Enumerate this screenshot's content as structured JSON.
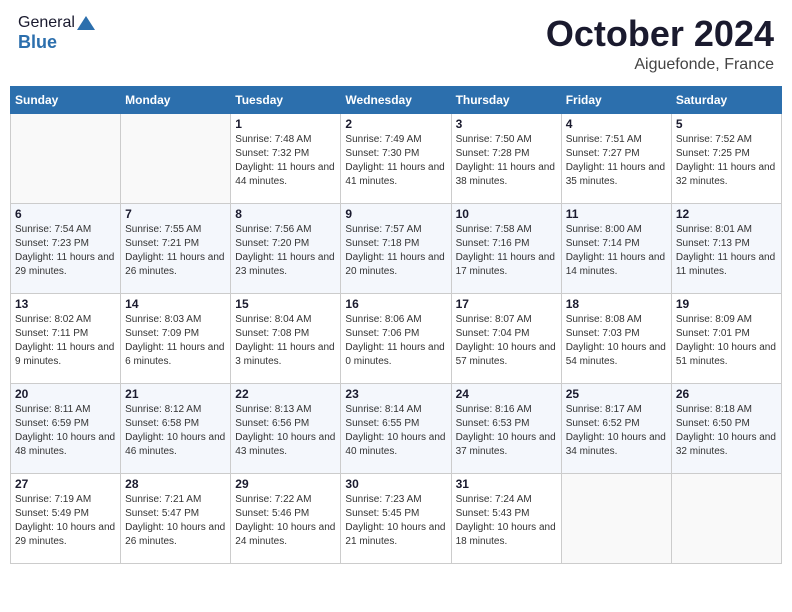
{
  "header": {
    "logo_general": "General",
    "logo_blue": "Blue",
    "month": "October 2024",
    "location": "Aiguefonde, France"
  },
  "weekdays": [
    "Sunday",
    "Monday",
    "Tuesday",
    "Wednesday",
    "Thursday",
    "Friday",
    "Saturday"
  ],
  "weeks": [
    [
      {
        "day": "",
        "info": ""
      },
      {
        "day": "",
        "info": ""
      },
      {
        "day": "1",
        "info": "Sunrise: 7:48 AM\nSunset: 7:32 PM\nDaylight: 11 hours and 44 minutes."
      },
      {
        "day": "2",
        "info": "Sunrise: 7:49 AM\nSunset: 7:30 PM\nDaylight: 11 hours and 41 minutes."
      },
      {
        "day": "3",
        "info": "Sunrise: 7:50 AM\nSunset: 7:28 PM\nDaylight: 11 hours and 38 minutes."
      },
      {
        "day": "4",
        "info": "Sunrise: 7:51 AM\nSunset: 7:27 PM\nDaylight: 11 hours and 35 minutes."
      },
      {
        "day": "5",
        "info": "Sunrise: 7:52 AM\nSunset: 7:25 PM\nDaylight: 11 hours and 32 minutes."
      }
    ],
    [
      {
        "day": "6",
        "info": "Sunrise: 7:54 AM\nSunset: 7:23 PM\nDaylight: 11 hours and 29 minutes."
      },
      {
        "day": "7",
        "info": "Sunrise: 7:55 AM\nSunset: 7:21 PM\nDaylight: 11 hours and 26 minutes."
      },
      {
        "day": "8",
        "info": "Sunrise: 7:56 AM\nSunset: 7:20 PM\nDaylight: 11 hours and 23 minutes."
      },
      {
        "day": "9",
        "info": "Sunrise: 7:57 AM\nSunset: 7:18 PM\nDaylight: 11 hours and 20 minutes."
      },
      {
        "day": "10",
        "info": "Sunrise: 7:58 AM\nSunset: 7:16 PM\nDaylight: 11 hours and 17 minutes."
      },
      {
        "day": "11",
        "info": "Sunrise: 8:00 AM\nSunset: 7:14 PM\nDaylight: 11 hours and 14 minutes."
      },
      {
        "day": "12",
        "info": "Sunrise: 8:01 AM\nSunset: 7:13 PM\nDaylight: 11 hours and 11 minutes."
      }
    ],
    [
      {
        "day": "13",
        "info": "Sunrise: 8:02 AM\nSunset: 7:11 PM\nDaylight: 11 hours and 9 minutes."
      },
      {
        "day": "14",
        "info": "Sunrise: 8:03 AM\nSunset: 7:09 PM\nDaylight: 11 hours and 6 minutes."
      },
      {
        "day": "15",
        "info": "Sunrise: 8:04 AM\nSunset: 7:08 PM\nDaylight: 11 hours and 3 minutes."
      },
      {
        "day": "16",
        "info": "Sunrise: 8:06 AM\nSunset: 7:06 PM\nDaylight: 11 hours and 0 minutes."
      },
      {
        "day": "17",
        "info": "Sunrise: 8:07 AM\nSunset: 7:04 PM\nDaylight: 10 hours and 57 minutes."
      },
      {
        "day": "18",
        "info": "Sunrise: 8:08 AM\nSunset: 7:03 PM\nDaylight: 10 hours and 54 minutes."
      },
      {
        "day": "19",
        "info": "Sunrise: 8:09 AM\nSunset: 7:01 PM\nDaylight: 10 hours and 51 minutes."
      }
    ],
    [
      {
        "day": "20",
        "info": "Sunrise: 8:11 AM\nSunset: 6:59 PM\nDaylight: 10 hours and 48 minutes."
      },
      {
        "day": "21",
        "info": "Sunrise: 8:12 AM\nSunset: 6:58 PM\nDaylight: 10 hours and 46 minutes."
      },
      {
        "day": "22",
        "info": "Sunrise: 8:13 AM\nSunset: 6:56 PM\nDaylight: 10 hours and 43 minutes."
      },
      {
        "day": "23",
        "info": "Sunrise: 8:14 AM\nSunset: 6:55 PM\nDaylight: 10 hours and 40 minutes."
      },
      {
        "day": "24",
        "info": "Sunrise: 8:16 AM\nSunset: 6:53 PM\nDaylight: 10 hours and 37 minutes."
      },
      {
        "day": "25",
        "info": "Sunrise: 8:17 AM\nSunset: 6:52 PM\nDaylight: 10 hours and 34 minutes."
      },
      {
        "day": "26",
        "info": "Sunrise: 8:18 AM\nSunset: 6:50 PM\nDaylight: 10 hours and 32 minutes."
      }
    ],
    [
      {
        "day": "27",
        "info": "Sunrise: 7:19 AM\nSunset: 5:49 PM\nDaylight: 10 hours and 29 minutes."
      },
      {
        "day": "28",
        "info": "Sunrise: 7:21 AM\nSunset: 5:47 PM\nDaylight: 10 hours and 26 minutes."
      },
      {
        "day": "29",
        "info": "Sunrise: 7:22 AM\nSunset: 5:46 PM\nDaylight: 10 hours and 24 minutes."
      },
      {
        "day": "30",
        "info": "Sunrise: 7:23 AM\nSunset: 5:45 PM\nDaylight: 10 hours and 21 minutes."
      },
      {
        "day": "31",
        "info": "Sunrise: 7:24 AM\nSunset: 5:43 PM\nDaylight: 10 hours and 18 minutes."
      },
      {
        "day": "",
        "info": ""
      },
      {
        "day": "",
        "info": ""
      }
    ]
  ]
}
